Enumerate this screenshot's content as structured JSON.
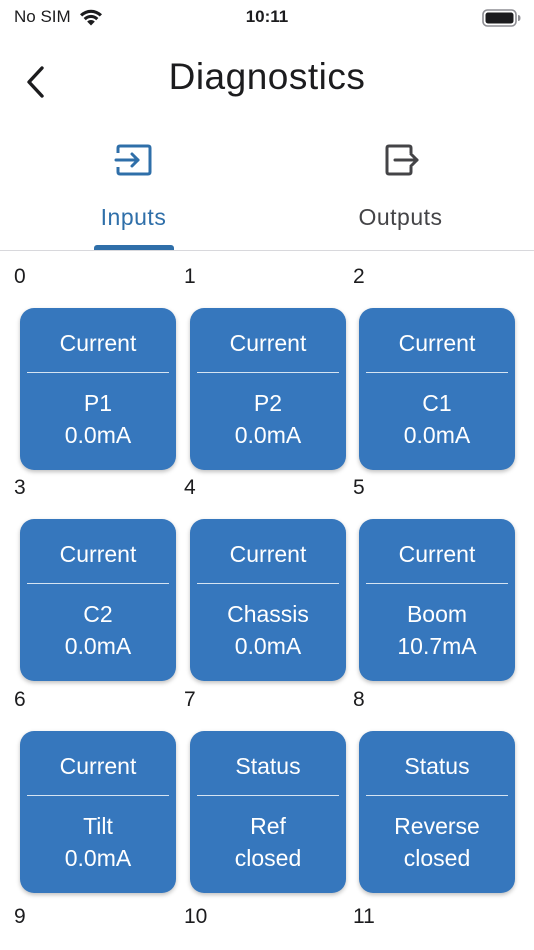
{
  "status_bar": {
    "carrier": "No SIM",
    "time": "10:11",
    "icons": [
      "wifi-icon",
      "battery-icon"
    ]
  },
  "nav": {
    "title": "Diagnostics",
    "back_icon": "chevron-left-icon"
  },
  "tabs": [
    {
      "label": "Inputs",
      "icon": "sign-in-icon",
      "active": true
    },
    {
      "label": "Outputs",
      "icon": "sign-out-icon",
      "active": false
    }
  ],
  "colors": {
    "accent": "#2f6fa9",
    "card": "#3677bd",
    "card_text": "#ffffff"
  },
  "channels": [
    {
      "index": "0",
      "type": "Current",
      "name": "P1",
      "value": "0.0mA"
    },
    {
      "index": "1",
      "type": "Current",
      "name": "P2",
      "value": "0.0mA"
    },
    {
      "index": "2",
      "type": "Current",
      "name": "C1",
      "value": "0.0mA"
    },
    {
      "index": "3",
      "type": "Current",
      "name": "C2",
      "value": "0.0mA"
    },
    {
      "index": "4",
      "type": "Current",
      "name": "Chassis",
      "value": "0.0mA"
    },
    {
      "index": "5",
      "type": "Current",
      "name": "Boom",
      "value": "10.7mA"
    },
    {
      "index": "6",
      "type": "Current",
      "name": "Tilt",
      "value": "0.0mA"
    },
    {
      "index": "7",
      "type": "Status",
      "name": "Ref",
      "value": "closed"
    },
    {
      "index": "8",
      "type": "Status",
      "name": "Reverse",
      "value": "closed"
    },
    {
      "index": "9"
    },
    {
      "index": "10"
    },
    {
      "index": "11"
    }
  ]
}
